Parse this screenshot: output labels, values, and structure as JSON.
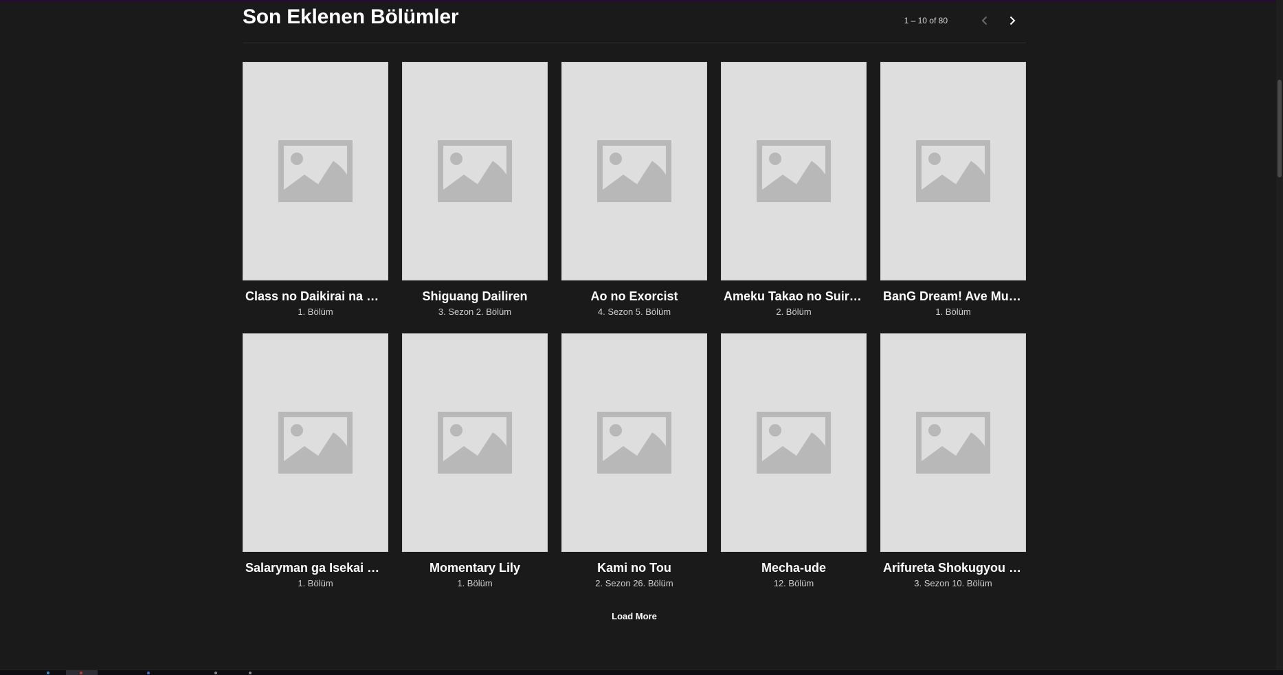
{
  "section": {
    "title": "Son Eklenen Bölümler",
    "range_text": "1 – 10 of 80",
    "prev_icon": "chevron-left-icon",
    "next_icon": "chevron-right-icon"
  },
  "cards": [
    {
      "title": "Class no Daikirai na Joshi to Kekkon suru Koto ni Natta.",
      "display_title": "Class no Daikirai na Jos…",
      "subtitle": "1. Bölüm"
    },
    {
      "title": "Shiguang Dailiren",
      "display_title": "Shiguang Dailiren",
      "subtitle": "3. Sezon 2. Bölüm"
    },
    {
      "title": "Ao no Exorcist",
      "display_title": "Ao no Exorcist",
      "subtitle": "4. Sezon 5. Bölüm"
    },
    {
      "title": "Ameku Takao no Suiri Karte",
      "display_title": "Ameku Takao no Suiri K…",
      "subtitle": "2. Bölüm"
    },
    {
      "title": "BanG Dream! Ave Mujica",
      "display_title": "BanG Dream! Ave Mujica",
      "subtitle": "1. Bölüm"
    },
    {
      "title": "Salaryman ga Isekai ni Ittara Shitennou ni Natta Hanashi",
      "display_title": "Salaryman ga Isekai ni I…",
      "subtitle": "1. Bölüm"
    },
    {
      "title": "Momentary Lily",
      "display_title": "Momentary Lily",
      "subtitle": "1. Bölüm"
    },
    {
      "title": "Kami no Tou",
      "display_title": "Kami no Tou",
      "subtitle": "2. Sezon 26. Bölüm"
    },
    {
      "title": "Mecha-ude",
      "display_title": "Mecha-ude",
      "subtitle": "12. Bölüm"
    },
    {
      "title": "Arifureta Shokugyou de Sekai Saikyou",
      "display_title": "Arifureta Shokugyou de…",
      "subtitle": "3. Sezon 10. Bölüm"
    }
  ],
  "load_more_label": "Load More",
  "colors": {
    "background": "#1a1a1a",
    "placeholder": "#dedede",
    "placeholder_icon": "#b8b8b8"
  }
}
